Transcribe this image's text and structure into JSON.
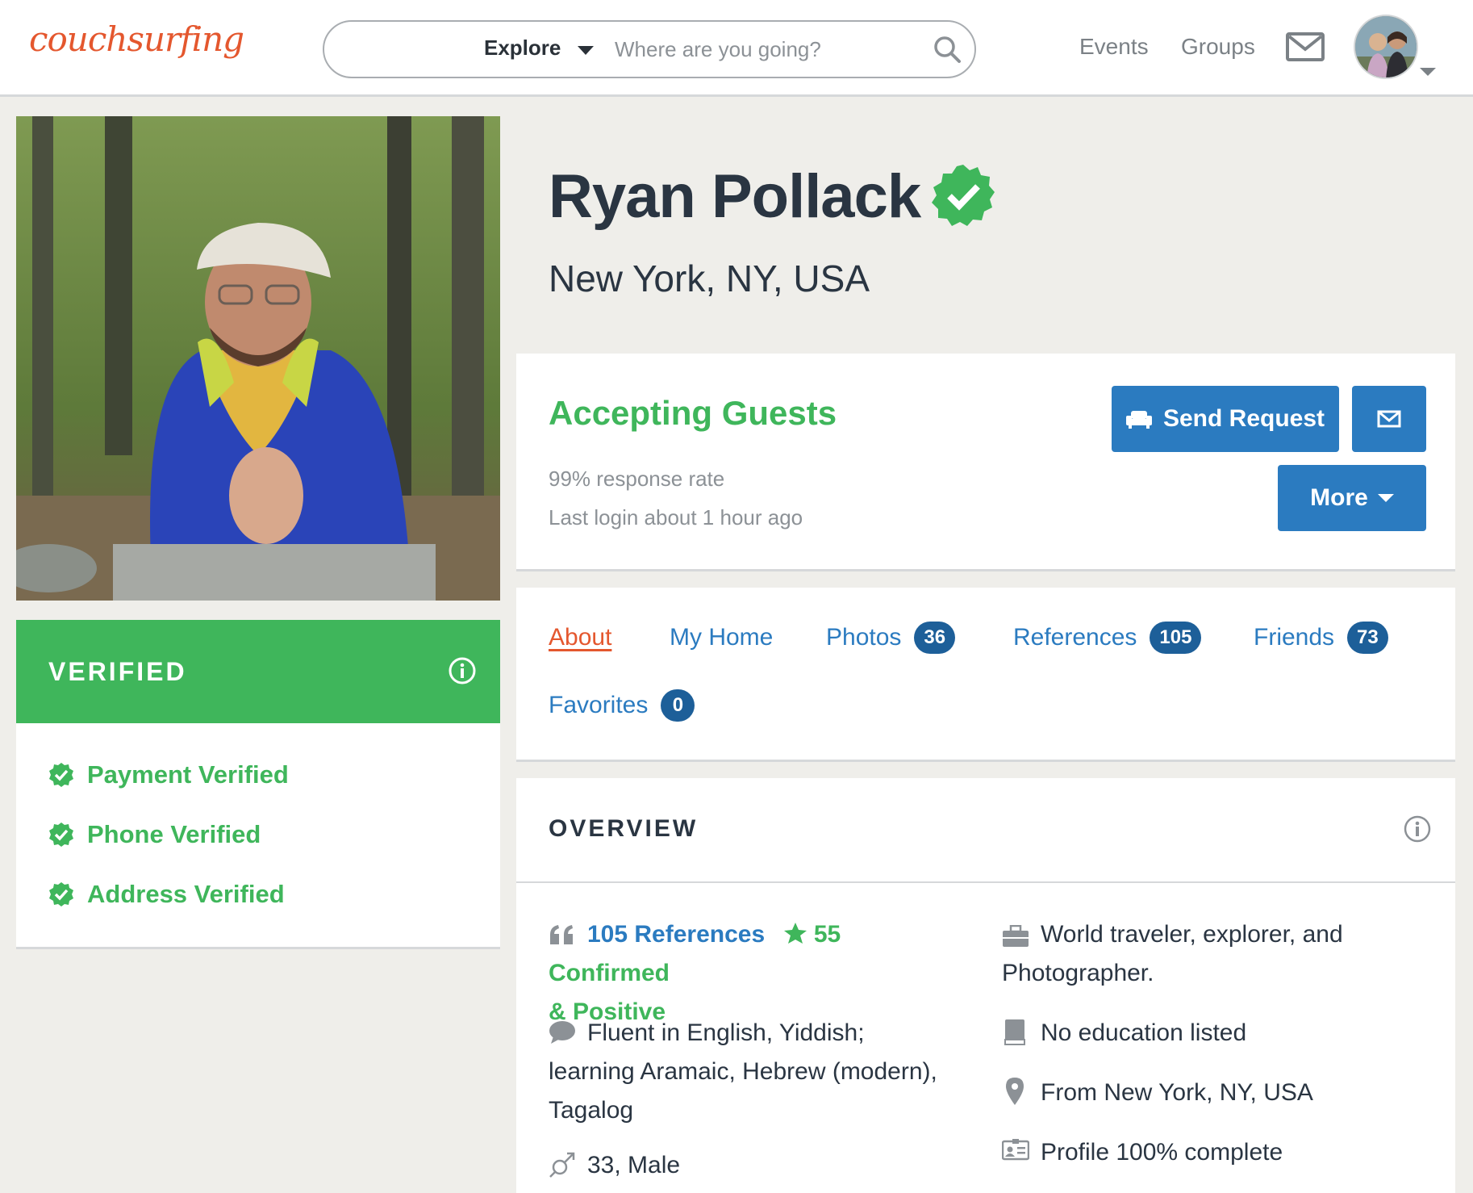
{
  "header": {
    "logo": "couchsurfing",
    "explore_label": "Explore",
    "search_placeholder": "Where are you going?",
    "nav": {
      "events": "Events",
      "groups": "Groups"
    }
  },
  "profile": {
    "name": "Ryan Pollack",
    "location": "New York, NY, USA"
  },
  "verification": {
    "title": "VERIFIED",
    "items": [
      {
        "label": "Payment Verified"
      },
      {
        "label": "Phone Verified"
      },
      {
        "label": "Address Verified"
      }
    ]
  },
  "status": {
    "title": "Accepting Guests",
    "response_rate": "99% response rate",
    "last_login": "Last login about 1 hour ago",
    "send_request": "Send Request",
    "more": "More"
  },
  "tabs": [
    {
      "label": "About",
      "active": true
    },
    {
      "label": "My Home"
    },
    {
      "label": "Photos",
      "count": "36"
    },
    {
      "label": "References",
      "count": "105"
    },
    {
      "label": "Friends",
      "count": "73"
    },
    {
      "label": "Favorites",
      "count": "0"
    }
  ],
  "overview": {
    "title": "OVERVIEW",
    "references": "105 References",
    "confirmed": "55 Confirmed",
    "positive": "& Positive",
    "languages_line1": "Fluent in English, Yiddish;",
    "languages_line2": "learning Aramaic, Hebrew (modern),",
    "languages_line3": "Tagalog",
    "age_gender": "33, Male",
    "occupation_line1": "World traveler, explorer, and",
    "occupation_line2": "Photographer.",
    "education": "No education listed",
    "hometown": "From New York, NY, USA",
    "completeness": "Profile 100% complete"
  },
  "colors": {
    "brand": "#e4572e",
    "accent_blue": "#2b7bc0",
    "badge_blue": "#1d5f99",
    "verified_green": "#3fb65b",
    "page_bg": "#efeeea"
  },
  "icons": [
    "search-icon",
    "mail-icon",
    "verified-badge-icon",
    "info-icon",
    "check-circle-icon",
    "couch-icon",
    "quote-icon",
    "star-icon",
    "speech-bubble-icon",
    "gender-icon",
    "briefcase-icon",
    "book-icon",
    "map-pin-icon",
    "id-card-icon"
  ]
}
